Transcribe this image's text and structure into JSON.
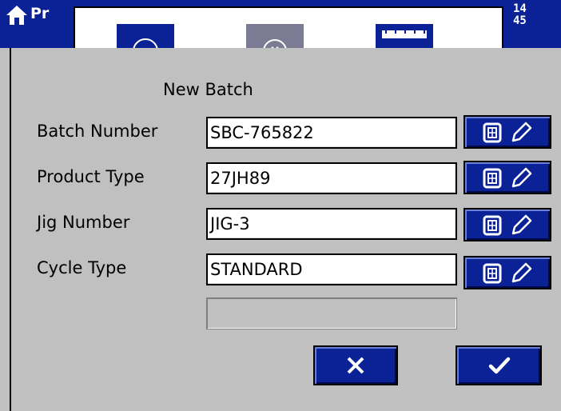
{
  "app": {
    "title_abbr": "Pr",
    "clock_line1": "14",
    "clock_line2": "45"
  },
  "toolbar": {
    "icons": [
      "circle-icon",
      "settings-dial-icon",
      "ruler-icon"
    ]
  },
  "form": {
    "heading": "New Batch",
    "fields": [
      {
        "label": "Batch Number",
        "value": "SBC-765822"
      },
      {
        "label": "Product Type",
        "value": "27JH89"
      },
      {
        "label": "Jig Number",
        "value": "JIG-3"
      },
      {
        "label": "Cycle Type",
        "value": "STANDARD"
      }
    ],
    "extra_field_value": ""
  },
  "actions": {
    "cancel_icon": "close-icon",
    "confirm_icon": "checkmark-icon"
  },
  "colors": {
    "accent": "#0a2296",
    "panel": "#c0c0c0",
    "field": "#ffffff"
  }
}
